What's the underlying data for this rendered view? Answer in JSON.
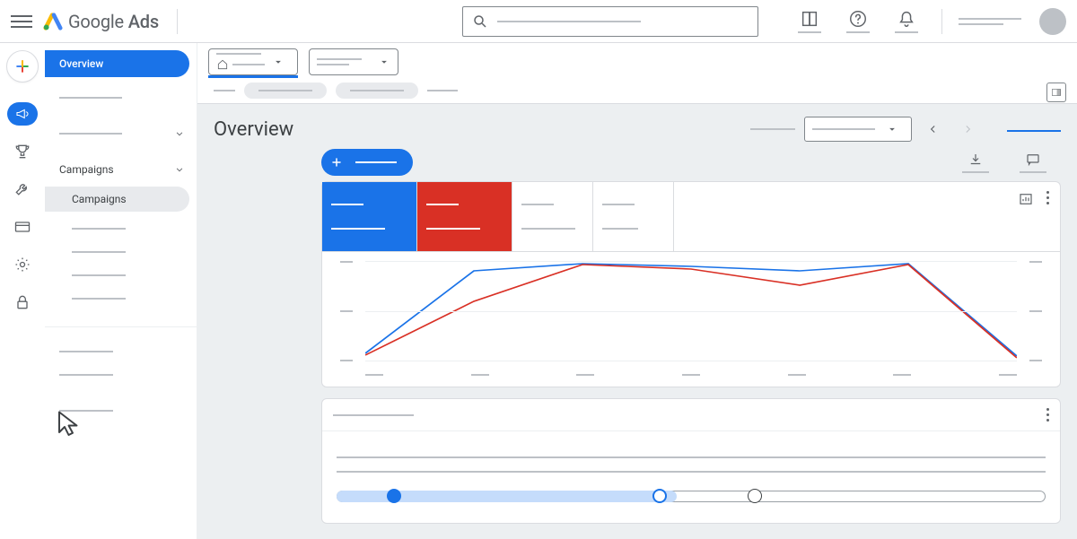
{
  "brand": {
    "name_primary": "Google",
    "name_secondary": "Ads"
  },
  "colors": {
    "primary": "#1a73e8",
    "danger": "#d93025",
    "grey": "#bdc1c6"
  },
  "nav": {
    "overview_label": "Overview",
    "campaigns_section": "Campaigns",
    "campaigns_item": "Campaigns"
  },
  "page": {
    "title": "Overview"
  },
  "chart_data": {
    "type": "line",
    "x": [
      0,
      1,
      2,
      3,
      4,
      5,
      6
    ],
    "series": [
      {
        "name": "metric_blue",
        "color": "#1a73e8",
        "values": [
          8,
          90,
          97,
          95,
          90,
          97,
          5
        ]
      },
      {
        "name": "metric_red",
        "color": "#d93025",
        "values": [
          6,
          60,
          96,
          92,
          76,
          96,
          4
        ]
      }
    ],
    "ylim": [
      0,
      100
    ],
    "grid_y": [
      0,
      50,
      100
    ]
  },
  "stepper": {
    "steps": 3,
    "completed": 1,
    "active_index": 1
  }
}
